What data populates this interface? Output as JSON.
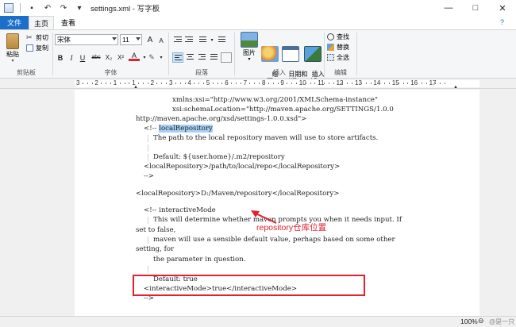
{
  "window": {
    "title": "settings.xml - 写字板",
    "buttons": [
      "—",
      "□",
      "✕"
    ]
  },
  "tabs": {
    "file": "文件",
    "home": "主页",
    "view": "查看"
  },
  "ribbon": {
    "clipboard": {
      "label": "剪贴板",
      "paste": "粘贴",
      "cut": "剪切",
      "copy": "复制"
    },
    "font": {
      "label": "字体",
      "family": "宋体",
      "size": "11",
      "grow": "A",
      "shrink": "A",
      "bold": "B",
      "italic": "I",
      "underline": "U",
      "strike": "abc",
      "sub": "X₂",
      "sup": "X²",
      "color": "A"
    },
    "paragraph": {
      "label": "段落"
    },
    "insert": {
      "label": "插入",
      "picture": "图片",
      "paint": "绘\n图",
      "datetime": "日期和\n时间",
      "object": "插入\n对象"
    },
    "edit": {
      "label": "编辑",
      "find": "查找",
      "replace": "替换",
      "select_all": "全选"
    }
  },
  "ruler": {
    "numbers": [
      "3",
      "2",
      "1",
      "1",
      "2",
      "3",
      "4",
      "5",
      "6",
      "7",
      "8",
      "9",
      "10",
      "11",
      "12",
      "13",
      "14",
      "15",
      "16",
      "17"
    ]
  },
  "document": {
    "lines": [
      {
        "text": "xmlns:xsi=\"http://www.w3.org/2001/XMLSchema-instance\"",
        "indent": 1
      },
      {
        "text": "xsi:schemaLocation=\"http://maven.apache.org/SETTINGS/1.0.0",
        "indent": 1
      },
      {
        "text": "http://maven.apache.org/xsd/settings-1.0.0.xsd\">",
        "indent": 0
      },
      {
        "text": "<!-- localRepository",
        "indent": 2
      },
      {
        "text": "The path to the local repository maven will use to store artifacts.",
        "indent": 3
      },
      {
        "text": "",
        "indent": 3
      },
      {
        "text": "Default: ${user.home}/.m2/repository",
        "indent": 3
      },
      {
        "text": "<localRepository>/path/to/local/repo</localRepository>",
        "indent": 2
      },
      {
        "text": "-->",
        "indent": 2
      },
      {
        "text": "<localRepository>D:/Maven/repository</localRepository>",
        "indent": 4
      },
      {
        "text": "<!-- interactiveMode",
        "indent": 2
      },
      {
        "text": "This will determine whether maven prompts you when it needs input. If",
        "indent": 3
      },
      {
        "text": "set to false,",
        "indent": 0
      },
      {
        "text": "maven will use a sensible default value, perhaps based on some other",
        "indent": 3
      },
      {
        "text": "setting, for",
        "indent": 0
      },
      {
        "text": "the parameter in question.",
        "indent": 3
      },
      {
        "text": "",
        "indent": 3
      },
      {
        "text": "Default: true",
        "indent": 3
      },
      {
        "text": "<interactiveMode>true</interactiveMode>",
        "indent": 2
      },
      {
        "text": "-->",
        "indent": 2
      }
    ],
    "highlight_word": "localRepository"
  },
  "annotation": {
    "text": "repository仓库位置",
    "color": "#e0212f"
  },
  "status": {
    "zoom": "100%",
    "watermark": "@是一只猩"
  },
  "colors": {
    "file_tab": "#1b6fc8",
    "selection": "#a8d0f4",
    "annotation": "#e0212f"
  }
}
